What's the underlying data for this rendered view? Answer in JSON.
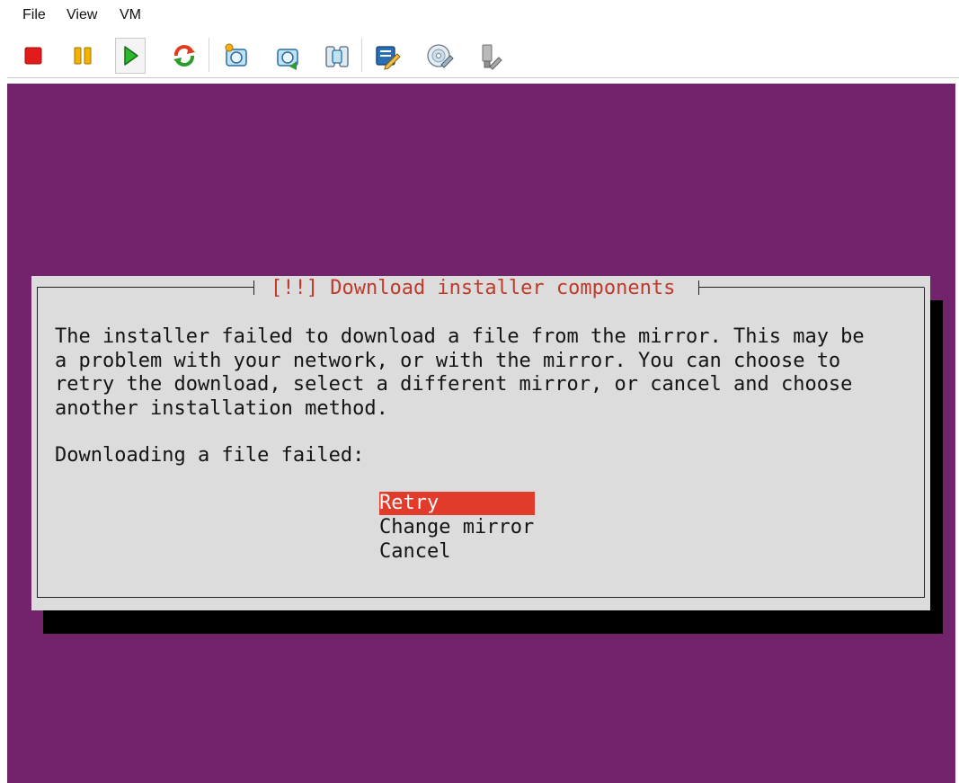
{
  "menu": {
    "items": [
      "File",
      "View",
      "VM"
    ]
  },
  "toolbar": {
    "buttons": [
      {
        "name": "stop-button",
        "icon": "stop-icon"
      },
      {
        "name": "pause-button",
        "icon": "pause-icon"
      },
      {
        "name": "start-button",
        "icon": "play-icon"
      },
      {
        "name": "reset-button",
        "icon": "reset-icon"
      },
      {
        "name": "take-snapshot-button",
        "icon": "camera-snapshot-icon"
      },
      {
        "name": "revert-snapshot-button",
        "icon": "camera-revert-icon"
      },
      {
        "name": "snapshot-manager-button",
        "icon": "snapshot-manager-icon"
      },
      {
        "name": "vm-settings-button",
        "icon": "settings-edit-icon"
      },
      {
        "name": "cd-dvd-button",
        "icon": "disc-icon"
      },
      {
        "name": "usb-button",
        "icon": "usb-icon"
      }
    ]
  },
  "dialog": {
    "title": "[!!] Download installer components",
    "body": "The installer failed to download a file from the mirror. This may be\na problem with your network, or with the mirror. You can choose to\nretry the download, select a different mirror, or cancel and choose\nanother installation method.",
    "prompt": "Downloading a file failed:",
    "options": [
      "Retry",
      "Change mirror",
      "Cancel"
    ],
    "selected_option": "Retry"
  },
  "colors": {
    "screen_background": "#73236b",
    "dialog_background": "#dcdcdc",
    "title_text": "#c0392b",
    "selection_highlight": "#e03b2b"
  }
}
